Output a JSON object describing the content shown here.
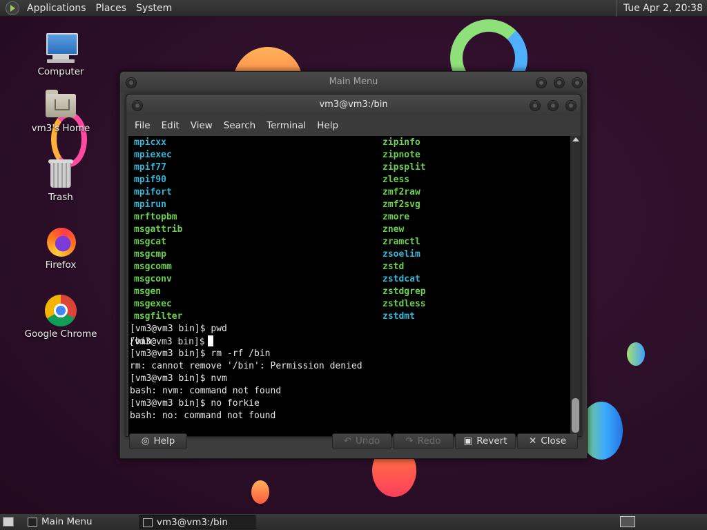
{
  "top_panel": {
    "menus": [
      "Applications",
      "Places",
      "System"
    ],
    "clock": "Tue Apr 2, 20:38"
  },
  "desktop_icons": [
    {
      "label": "Computer",
      "icon": "computer-icon"
    },
    {
      "label": "vm3's Home",
      "icon": "home-folder-icon"
    },
    {
      "label": "Trash",
      "icon": "trash-icon"
    },
    {
      "label": "Firefox",
      "icon": "firefox-icon"
    },
    {
      "label": "Google Chrome",
      "icon": "chrome-icon"
    }
  ],
  "main_menu_window": {
    "title": "Main Menu",
    "buttons": {
      "help": "Help",
      "undo": "Undo",
      "redo": "Redo",
      "revert": "Revert",
      "close": "Close"
    }
  },
  "terminal": {
    "title": "vm3@vm3:/bin",
    "menu": [
      "File",
      "Edit",
      "View",
      "Search",
      "Terminal",
      "Help"
    ],
    "listing_left": [
      {
        "text": "mpicxx",
        "color": "cyan"
      },
      {
        "text": "mpiexec",
        "color": "cyan"
      },
      {
        "text": "mpif77",
        "color": "cyan"
      },
      {
        "text": "mpif90",
        "color": "cyan"
      },
      {
        "text": "mpifort",
        "color": "cyan"
      },
      {
        "text": "mpirun",
        "color": "cyan"
      },
      {
        "text": "mrftopbm",
        "color": "green"
      },
      {
        "text": "msgattrib",
        "color": "green"
      },
      {
        "text": "msgcat",
        "color": "green"
      },
      {
        "text": "msgcmp",
        "color": "green"
      },
      {
        "text": "msgcomm",
        "color": "green"
      },
      {
        "text": "msgconv",
        "color": "green"
      },
      {
        "text": "msgen",
        "color": "green"
      },
      {
        "text": "msgexec",
        "color": "green"
      },
      {
        "text": "msgfilter",
        "color": "green"
      }
    ],
    "listing_right": [
      {
        "text": "zipinfo",
        "color": "green"
      },
      {
        "text": "zipnote",
        "color": "green"
      },
      {
        "text": "zipsplit",
        "color": "green"
      },
      {
        "text": "zless",
        "color": "green"
      },
      {
        "text": "zmf2raw",
        "color": "green"
      },
      {
        "text": "zmf2svg",
        "color": "green"
      },
      {
        "text": "zmore",
        "color": "green"
      },
      {
        "text": "znew",
        "color": "green"
      },
      {
        "text": "zramctl",
        "color": "green"
      },
      {
        "text": "zsoelim",
        "color": "cyan"
      },
      {
        "text": "zstd",
        "color": "green"
      },
      {
        "text": "zstdcat",
        "color": "cyan"
      },
      {
        "text": "zstdgrep",
        "color": "green"
      },
      {
        "text": "zstdless",
        "color": "green"
      },
      {
        "text": "zstdmt",
        "color": "cyan"
      }
    ],
    "session": [
      "[vm3@vm3 bin]$ pwd",
      "/bin",
      "[vm3@vm3 bin]$ rm -rf /bin",
      "rm: cannot remove '/bin': Permission denied",
      "[vm3@vm3 bin]$ nvm",
      "bash: nvm: command not found",
      "[vm3@vm3 bin]$ no forkie",
      "bash: no: command not found"
    ],
    "prompt": "[vm3@vm3 bin]$"
  },
  "taskbar": {
    "tasks": [
      "Main Menu",
      "vm3@vm3:/bin"
    ]
  }
}
